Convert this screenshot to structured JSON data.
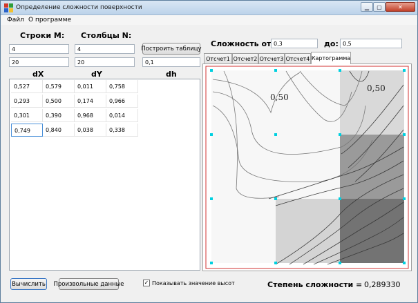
{
  "window": {
    "title": "Определение сложности поверхности"
  },
  "menu": [
    {
      "label": "Файл"
    },
    {
      "label": "О программе"
    }
  ],
  "rows_label": "Строки M:",
  "cols_label": "Столбцы N:",
  "rows_value": "4",
  "cols_value": "4",
  "row2_left_value": "20",
  "row2_mid_value": "20",
  "dh_input_value": "0,1",
  "build_button": "Построить таблицу",
  "complexity_from_label": "Сложность от:",
  "complexity_from_value": "0,3",
  "complexity_to_label": "до:",
  "complexity_to_value": "0,5",
  "columns": {
    "dx": "dX",
    "dy": "dY",
    "dh": "dh"
  },
  "table": [
    [
      "0,527",
      "0,579",
      "0,011",
      "0,758"
    ],
    [
      "0,293",
      "0,500",
      "0,174",
      "0,966"
    ],
    [
      "0,301",
      "0,390",
      "0,968",
      "0,014"
    ],
    [
      "0,749",
      "0,840",
      "0,038",
      "0,338"
    ]
  ],
  "tabs": [
    {
      "label": "Отсчет1",
      "active": false
    },
    {
      "label": "Отсчет2",
      "active": false
    },
    {
      "label": "Отсчет3",
      "active": false
    },
    {
      "label": "Отсчет4",
      "active": false
    },
    {
      "label": "Картограмма",
      "active": true
    }
  ],
  "map": {
    "contour_labels": [
      "0,50",
      "0,50"
    ],
    "cell_shades": [
      [
        "#f7f7f7",
        "#f7f7f7",
        "#d9d9d9"
      ],
      [
        "#f7f7f7",
        "#f7f7f7",
        "#9a9a9a"
      ],
      [
        "#f7f7f7",
        "#d4d4d4",
        "#737373"
      ]
    ],
    "frame_color": "#d03030",
    "marker_color": "#00d0e0"
  },
  "calc_button": "Вычислить",
  "random_button": "Произвольные данные",
  "show_heights_label": "Показывать значение высот",
  "show_heights_checked": true,
  "result_label": "Степень сложности =",
  "result_value": "0,289330"
}
